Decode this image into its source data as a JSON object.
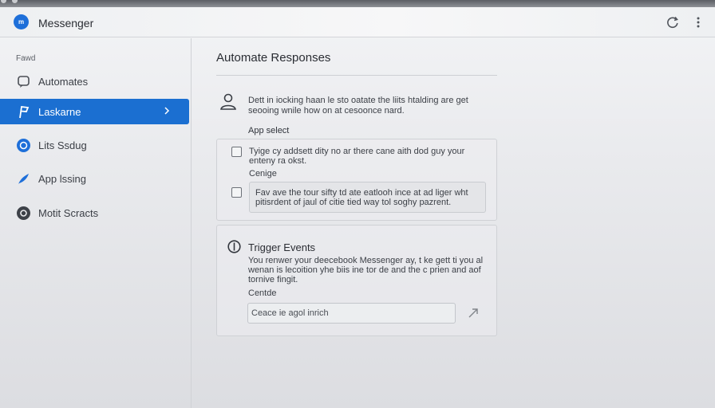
{
  "app": {
    "title": "Messenger",
    "logo_text": "m",
    "accent": "#1b6fd1"
  },
  "header": {
    "icons": [
      "refresh-icon",
      "more-vertical-icon"
    ]
  },
  "sidebar": {
    "section_label": "Fawd",
    "items": [
      {
        "label": "Automates",
        "icon": "chat-bubble-icon",
        "active": false
      },
      {
        "label": "Laskarne",
        "icon": "flag-icon",
        "active": true
      },
      {
        "label": "Lits Ssdug",
        "icon": "circle-badge-icon",
        "active": false
      },
      {
        "label": "App lssing",
        "icon": "arrow-leaf-icon",
        "active": false
      },
      {
        "label": "Motit Scracts",
        "icon": "gear-icon",
        "active": false
      }
    ]
  },
  "main": {
    "title": "Automate Responses",
    "description": "Dett in iocking haan le sto oatate the liits htalding are get seooing wnile how on at cesoonce nard.",
    "app_select_label": "App select",
    "option1": "Tyige cy addsett dity no ar there cane aith dod guy your enteny ra okst.",
    "config_label": "Cenige",
    "option2": "Fav ave the tour sifty td ate eatlooh ince at ad liger wht pitisrdent of jaul of citie tied way tol soghy pazrent.",
    "trigger": {
      "title": "Trigger Events",
      "description": "You renwer your deecebook Messenger ay, t ke gett ti you al wenan is lecoition yhe biis ine tor de and the c prien and aof tornive fingit.",
      "field_label": "Centde",
      "input_value": "Ceace ie agol inrich"
    }
  }
}
